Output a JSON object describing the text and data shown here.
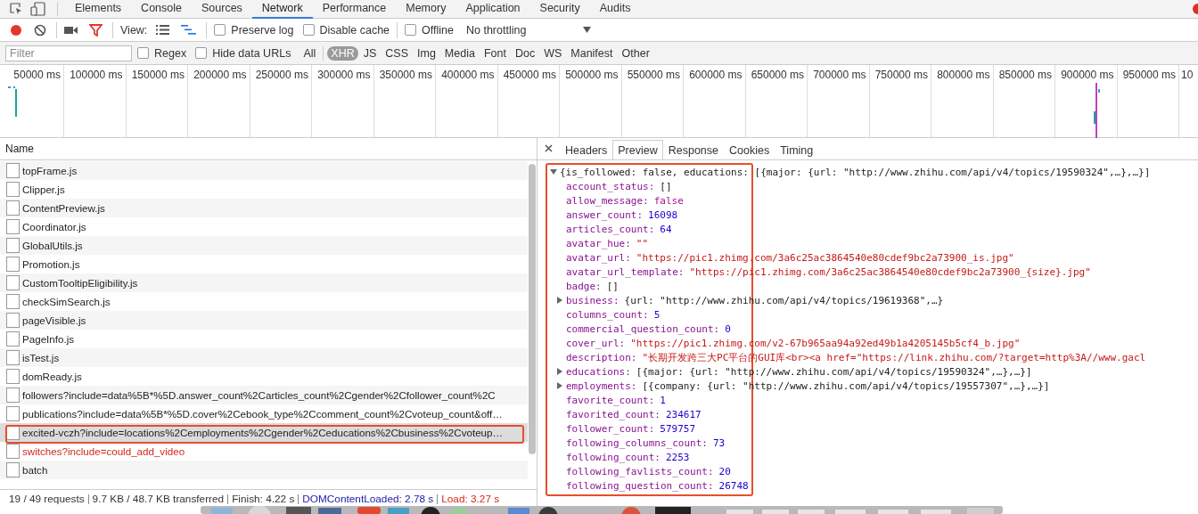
{
  "devtools_tabs": [
    {
      "label": "Elements",
      "selected": false
    },
    {
      "label": "Console",
      "selected": false
    },
    {
      "label": "Sources",
      "selected": false
    },
    {
      "label": "Network",
      "selected": true
    },
    {
      "label": "Performance",
      "selected": false
    },
    {
      "label": "Memory",
      "selected": false
    },
    {
      "label": "Application",
      "selected": false
    },
    {
      "label": "Security",
      "selected": false
    },
    {
      "label": "Audits",
      "selected": false
    }
  ],
  "toolbar": {
    "recording": true,
    "filter_active": true,
    "view_label": "View:",
    "waterfall_view": true,
    "options": [
      {
        "label": "Preserve log",
        "checked": false
      },
      {
        "label": "Disable cache",
        "checked": false
      }
    ],
    "offline": {
      "label": "Offline",
      "checked": false
    },
    "throttling": "No throttling"
  },
  "filter": {
    "placeholder": "Filter",
    "options": [
      {
        "label": "Regex",
        "checked": false
      },
      {
        "label": "Hide data URLs",
        "checked": false
      }
    ],
    "types": [
      {
        "label": "All",
        "selected": false
      },
      {
        "label": "XHR",
        "selected": true
      },
      {
        "label": "JS",
        "selected": false
      },
      {
        "label": "CSS",
        "selected": false
      },
      {
        "label": "Img",
        "selected": false
      },
      {
        "label": "Media",
        "selected": false
      },
      {
        "label": "Font",
        "selected": false
      },
      {
        "label": "Doc",
        "selected": false
      },
      {
        "label": "WS",
        "selected": false
      },
      {
        "label": "Manifest",
        "selected": false
      },
      {
        "label": "Other",
        "selected": false
      }
    ]
  },
  "timeline": {
    "ticks": [
      "50000 ms",
      "100000 ms",
      "150000 ms",
      "200000 ms",
      "250000 ms",
      "300000 ms",
      "350000 ms",
      "400000 ms",
      "450000 ms",
      "500000 ms",
      "550000 ms",
      "600000 ms",
      "650000 ms",
      "700000 ms",
      "750000 ms",
      "800000 ms",
      "850000 ms",
      "900000 ms",
      "950000 ms",
      "10"
    ]
  },
  "requests": {
    "header": "Name",
    "rows": [
      {
        "name": "topFrame.js",
        "selected": false,
        "failed": false
      },
      {
        "name": "Clipper.js",
        "selected": false,
        "failed": false
      },
      {
        "name": "ContentPreview.js",
        "selected": false,
        "failed": false
      },
      {
        "name": "Coordinator.js",
        "selected": false,
        "failed": false
      },
      {
        "name": "GlobalUtils.js",
        "selected": false,
        "failed": false
      },
      {
        "name": "Promotion.js",
        "selected": false,
        "failed": false
      },
      {
        "name": "CustomTooltipEligibility.js",
        "selected": false,
        "failed": false
      },
      {
        "name": "checkSimSearch.js",
        "selected": false,
        "failed": false
      },
      {
        "name": "pageVisible.js",
        "selected": false,
        "failed": false
      },
      {
        "name": "PageInfo.js",
        "selected": false,
        "failed": false
      },
      {
        "name": "isTest.js",
        "selected": false,
        "failed": false
      },
      {
        "name": "domReady.js",
        "selected": false,
        "failed": false
      },
      {
        "name": "followers?include=data%5B*%5D.answer_count%2Carticles_count%2Cgender%2Cfollower_count%2C",
        "selected": false,
        "failed": false
      },
      {
        "name": "publications?include=data%5B*%5D.cover%2Cebook_type%2Ccomment_count%2Cvoteup_count&off…",
        "selected": false,
        "failed": false
      },
      {
        "name": "excited-vczh?include=locations%2Cemployments%2Cgender%2Ceducations%2Cbusiness%2Cvoteup…",
        "selected": true,
        "failed": false
      },
      {
        "name": "switches?include=could_add_video",
        "selected": false,
        "failed": true
      },
      {
        "name": "batch",
        "selected": false,
        "failed": false
      }
    ]
  },
  "status_bar": [
    {
      "text": "19 / 49 requests",
      "kind": "plain"
    },
    {
      "text": "9.7 KB / 48.7 KB transferred",
      "kind": "plain"
    },
    {
      "text": "Finish: 4.22 s",
      "kind": "plain"
    },
    {
      "text": "DOMContentLoaded: 2.78 s",
      "kind": "domcontentloaded"
    },
    {
      "text": "Load: 3.27 s",
      "kind": "load"
    }
  ],
  "detail_tabs": [
    {
      "label": "Headers",
      "selected": false
    },
    {
      "label": "Preview",
      "selected": true
    },
    {
      "label": "Response",
      "selected": false
    },
    {
      "label": "Cookies",
      "selected": false
    },
    {
      "label": "Timing",
      "selected": false
    }
  ],
  "preview": {
    "summary": "{is_followed: false, educations: [{major: {url: \"http://www.zhihu.com/api/v4/topics/19590324\",…},…}]",
    "expanded": true,
    "lines": [
      {
        "key": "account_status:",
        "value": "[]",
        "kind": "object",
        "expandable": false
      },
      {
        "key": "allow_message:",
        "value": "false",
        "kind": "keyword",
        "expandable": false
      },
      {
        "key": "answer_count:",
        "value": "16098",
        "kind": "number",
        "expandable": false
      },
      {
        "key": "articles_count:",
        "value": "64",
        "kind": "number",
        "expandable": false
      },
      {
        "key": "avatar_hue:",
        "value": "\"\"",
        "kind": "string",
        "expandable": false
      },
      {
        "key": "avatar_url:",
        "value": "\"https://pic1.zhimg.com/3a6c25ac3864540e80cdef9bc2a73900_is.jpg\"",
        "kind": "string",
        "expandable": false
      },
      {
        "key": "avatar_url_template:",
        "value": "\"https://pic1.zhimg.com/3a6c25ac3864540e80cdef9bc2a73900_{size}.jpg\"",
        "kind": "string",
        "expandable": false
      },
      {
        "key": "badge:",
        "value": "[]",
        "kind": "object",
        "expandable": false
      },
      {
        "key": "business:",
        "value": "{url: \"http://www.zhihu.com/api/v4/topics/19619368\",…}",
        "kind": "object",
        "expandable": true
      },
      {
        "key": "columns_count:",
        "value": "5",
        "kind": "number",
        "expandable": false
      },
      {
        "key": "commercial_question_count:",
        "value": "0",
        "kind": "number",
        "expandable": false
      },
      {
        "key": "cover_url:",
        "value": "\"https://pic1.zhimg.com/v2-67b965aa94a92ed49b1a4205145b5cf4_b.jpg\"",
        "kind": "string",
        "expandable": false
      },
      {
        "key": "description:",
        "value": "\"长期开发跨三大PC平台的GUI库<br><a href=\"https://link.zhihu.com/?target=http%3A//www.gacl",
        "kind": "string",
        "expandable": false
      },
      {
        "key": "educations:",
        "value": "[{major: {url: \"http://www.zhihu.com/api/v4/topics/19590324\",…},…}]",
        "kind": "object",
        "expandable": true
      },
      {
        "key": "employments:",
        "value": "[{company: {url: \"http://www.zhihu.com/api/v4/topics/19557307\",…},…}]",
        "kind": "object",
        "expandable": true
      },
      {
        "key": "favorite_count:",
        "value": "1",
        "kind": "number",
        "expandable": false
      },
      {
        "key": "favorited_count:",
        "value": "234617",
        "kind": "number",
        "expandable": false
      },
      {
        "key": "follower_count:",
        "value": "579757",
        "kind": "number",
        "expandable": false
      },
      {
        "key": "following_columns_count:",
        "value": "73",
        "kind": "number",
        "expandable": false
      },
      {
        "key": "following_count:",
        "value": "2253",
        "kind": "number",
        "expandable": false
      },
      {
        "key": "following_favlists_count:",
        "value": "20",
        "kind": "number",
        "expandable": false
      },
      {
        "key": "following_question_count:",
        "value": "26748",
        "kind": "number",
        "expandable": false
      }
    ]
  }
}
